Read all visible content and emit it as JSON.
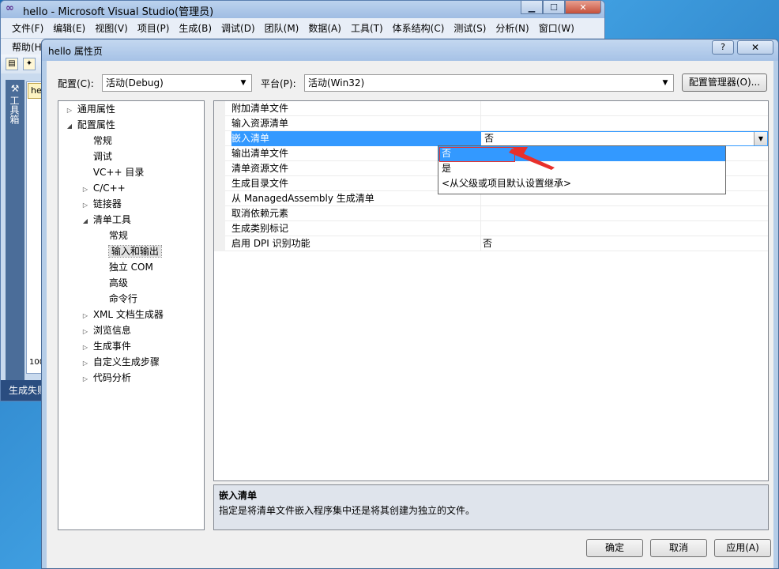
{
  "vs": {
    "title": "hello - Microsoft Visual Studio(管理员)",
    "menu": [
      "文件(F)",
      "编辑(E)",
      "视图(V)",
      "项目(P)",
      "生成(B)",
      "调试(D)",
      "团队(M)",
      "数据(A)",
      "工具(T)",
      "体系结构(C)",
      "测试(S)",
      "分析(N)",
      "窗口(W)"
    ],
    "menu_row2": "帮助(H)",
    "toolbox_label": "工具箱",
    "doc_tab": "he",
    "zoom": "100",
    "status": "生成失败"
  },
  "dialog": {
    "title": "hello 属性页",
    "help": "?",
    "close": "✕",
    "config_label": "配置(C):",
    "config_value": "活动(Debug)",
    "platform_label": "平台(P):",
    "platform_value": "活动(Win32)",
    "config_manager": "配置管理器(O)...",
    "ok": "确定",
    "cancel": "取消",
    "apply": "应用(A)"
  },
  "tree": [
    {
      "label": "通用属性",
      "exp": "▷"
    },
    {
      "label": "配置属性",
      "exp": "◢"
    },
    {
      "label": "常规",
      "exp": ""
    },
    {
      "label": "调试",
      "exp": ""
    },
    {
      "label": "VC++ 目录",
      "exp": ""
    },
    {
      "label": "C/C++",
      "exp": "▷"
    },
    {
      "label": "链接器",
      "exp": "▷"
    },
    {
      "label": "清单工具",
      "exp": "◢"
    },
    {
      "label": "常规",
      "exp": ""
    },
    {
      "label": "输入和输出",
      "exp": ""
    },
    {
      "label": "独立 COM",
      "exp": ""
    },
    {
      "label": "高级",
      "exp": ""
    },
    {
      "label": "命令行",
      "exp": ""
    },
    {
      "label": "XML 文档生成器",
      "exp": "▷"
    },
    {
      "label": "浏览信息",
      "exp": "▷"
    },
    {
      "label": "生成事件",
      "exp": "▷"
    },
    {
      "label": "自定义生成步骤",
      "exp": "▷"
    },
    {
      "label": "代码分析",
      "exp": "▷"
    }
  ],
  "grid": [
    {
      "name": "附加清单文件",
      "value": ""
    },
    {
      "name": "输入资源清单",
      "value": ""
    },
    {
      "name": "嵌入清单",
      "value": "否"
    },
    {
      "name": "输出清单文件",
      "value": ""
    },
    {
      "name": "清单资源文件",
      "value": ""
    },
    {
      "name": "生成目录文件",
      "value": ""
    },
    {
      "name": "从 ManagedAssembly 生成清单",
      "value": ""
    },
    {
      "name": "取消依赖元素",
      "value": ""
    },
    {
      "name": "生成类别标记",
      "value": ""
    },
    {
      "name": "启用 DPI 识别功能",
      "value": "否"
    }
  ],
  "dropdown_options": [
    "否",
    "是",
    "<从父级或项目默认设置继承>"
  ],
  "description": {
    "title": "嵌入清单",
    "text": "指定是将清单文件嵌入程序集中还是将其创建为独立的文件。"
  }
}
